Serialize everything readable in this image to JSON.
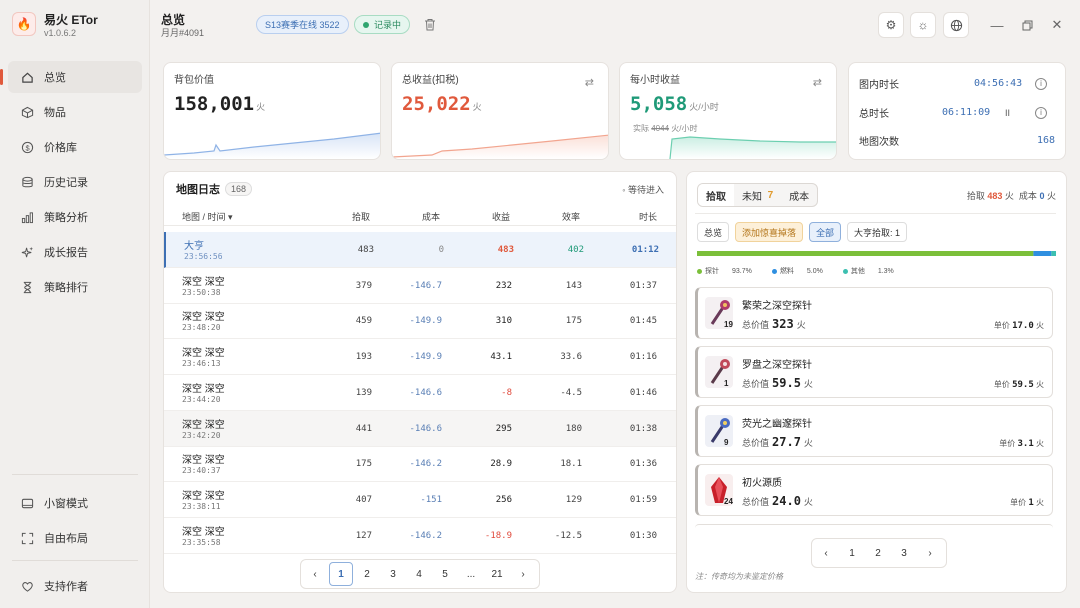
{
  "app": {
    "name": "易火 ETor",
    "version": "v1.0.6.2"
  },
  "sidebar": {
    "items": [
      {
        "label": "总览",
        "icon": "home-icon"
      },
      {
        "label": "物品",
        "icon": "box-icon"
      },
      {
        "label": "价格库",
        "icon": "dollar-icon"
      },
      {
        "label": "历史记录",
        "icon": "database-icon"
      },
      {
        "label": "策略分析",
        "icon": "bar-chart-icon"
      },
      {
        "label": "成长报告",
        "icon": "sparkle-icon"
      },
      {
        "label": "策略排行",
        "icon": "hourglass-icon"
      }
    ],
    "bottom": [
      {
        "label": "小窗模式",
        "icon": "window-icon"
      },
      {
        "label": "自由布局",
        "icon": "expand-icon"
      },
      {
        "label": "支持作者",
        "icon": "heart-icon"
      }
    ]
  },
  "header": {
    "title": "总览",
    "subtitle": "月月#4091",
    "season_pill": "S13赛季在线 3522",
    "recording_pill": "记录中"
  },
  "stats": {
    "backpack": {
      "label": "背包价值",
      "value": "158,001",
      "unit": "火"
    },
    "total_income": {
      "label": "总收益(扣税)",
      "value": "25,022",
      "unit": "火"
    },
    "hourly": {
      "label": "每小时收益",
      "value": "5,058",
      "unit": "火/小时",
      "actual_label": "实际",
      "actual_value": "4044",
      "actual_unit": "火/小时"
    },
    "timers": {
      "map_time_label": "图内时长",
      "map_time": "04:56:43",
      "total_time_label": "总时长",
      "total_time": "06:11:09",
      "pause": "II",
      "map_count_label": "地图次数",
      "map_count": "168"
    }
  },
  "map_log": {
    "title": "地图日志",
    "count": "168",
    "waiting": "等待进入",
    "columns": [
      "地图 / 时间 ▾",
      "拾取",
      "成本",
      "收益",
      "效率",
      "时长"
    ],
    "rows": [
      {
        "name": "大亨",
        "time": "23:56:56",
        "pickup": "483",
        "cost": "0",
        "income": "483",
        "eff": "402",
        "dur": "01:12"
      },
      {
        "name": "深空 深空",
        "time": "23:50:38",
        "pickup": "379",
        "cost": "-146.7",
        "income": "232",
        "eff": "143",
        "dur": "01:37"
      },
      {
        "name": "深空 深空",
        "time": "23:48:20",
        "pickup": "459",
        "cost": "-149.9",
        "income": "310",
        "eff": "175",
        "dur": "01:45"
      },
      {
        "name": "深空 深空",
        "time": "23:46:13",
        "pickup": "193",
        "cost": "-149.9",
        "income": "43.1",
        "eff": "33.6",
        "dur": "01:16"
      },
      {
        "name": "深空 深空",
        "time": "23:44:20",
        "pickup": "139",
        "cost": "-146.6",
        "income": "-8",
        "eff": "-4.5",
        "dur": "01:46"
      },
      {
        "name": "深空 深空",
        "time": "23:42:20",
        "pickup": "441",
        "cost": "-146.6",
        "income": "295",
        "eff": "180",
        "dur": "01:38"
      },
      {
        "name": "深空 深空",
        "time": "23:40:37",
        "pickup": "175",
        "cost": "-146.2",
        "income": "28.9",
        "eff": "18.1",
        "dur": "01:36"
      },
      {
        "name": "深空 深空",
        "time": "23:38:11",
        "pickup": "407",
        "cost": "-151",
        "income": "256",
        "eff": "129",
        "dur": "01:59"
      },
      {
        "name": "深空 深空",
        "time": "23:35:58",
        "pickup": "127",
        "cost": "-146.2",
        "income": "-18.9",
        "eff": "-12.5",
        "dur": "01:30"
      }
    ],
    "pages": [
      "1",
      "2",
      "3",
      "4",
      "5",
      "...",
      "21"
    ]
  },
  "drops": {
    "tabs": [
      "拾取",
      "未知",
      "成本"
    ],
    "unknown_count": "7",
    "summary_pickup_label": "拾取",
    "summary_pickup": "483",
    "summary_unit": "火",
    "summary_cost_label": "成本",
    "summary_cost": "0",
    "filters": [
      "总览",
      "添加惊喜掉落",
      "全部",
      "大亨拾取: 1"
    ],
    "legend": [
      {
        "label": "探针",
        "pct": "93.7%",
        "color": "#7bbf3a"
      },
      {
        "label": "燃料",
        "pct": "5.0%",
        "color": "#2f8fe0"
      },
      {
        "label": "其他",
        "pct": "1.3%",
        "color": "#3cbfb0"
      }
    ],
    "items": [
      {
        "name": "繁荣之深空探针",
        "count": "19",
        "total_label": "总价值",
        "total": "323",
        "unit": "火",
        "unit_label": "单价",
        "unit_price": "17.0"
      },
      {
        "name": "罗盘之深空探针",
        "count": "1",
        "total_label": "总价值",
        "total": "59.5",
        "unit": "火",
        "unit_label": "单价",
        "unit_price": "59.5"
      },
      {
        "name": "荧光之幽邃探针",
        "count": "9",
        "total_label": "总价值",
        "total": "27.7",
        "unit": "火",
        "unit_label": "单价",
        "unit_price": "3.1"
      },
      {
        "name": "初火源质",
        "count": "24",
        "total_label": "总价值",
        "total": "24.0",
        "unit": "火",
        "unit_label": "单价",
        "unit_price": "1"
      }
    ],
    "pages": [
      "1",
      "2",
      "3"
    ],
    "note": "注：传奇均为未鉴定价格"
  },
  "colors": {
    "accent": "#e0593c",
    "income": "#e0593c",
    "hourly": "#1f9a78",
    "time": "#3d6fb3",
    "negative": "#e04a3c"
  }
}
